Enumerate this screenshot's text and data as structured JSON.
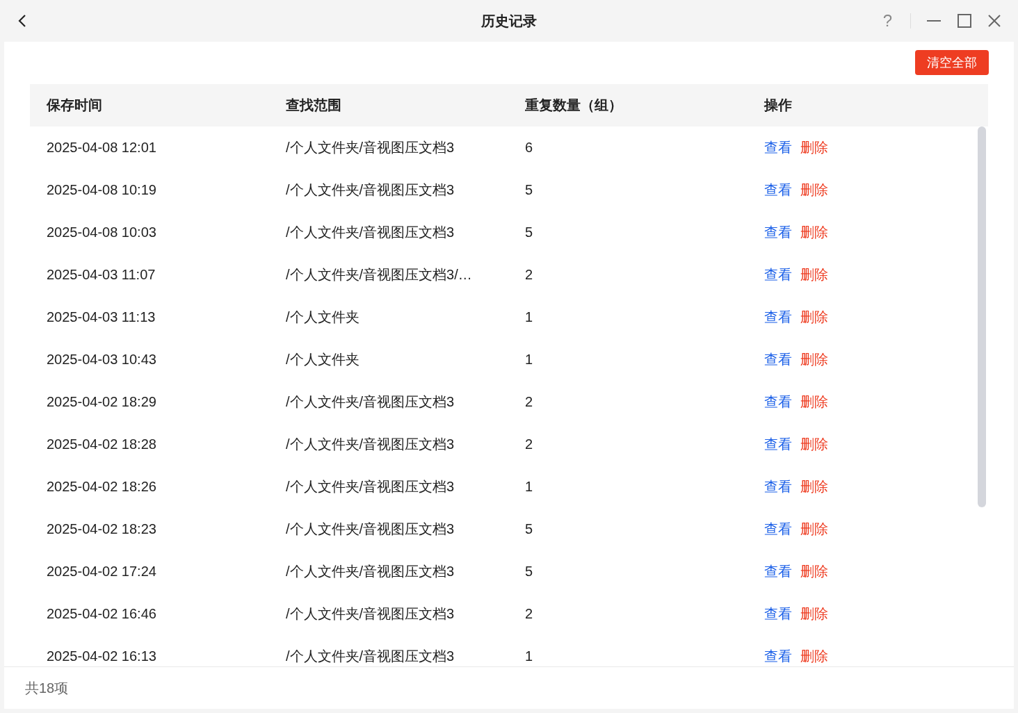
{
  "window": {
    "title": "历史记录",
    "help": "?"
  },
  "clear_all_button": "清空全部",
  "table": {
    "columns": [
      "保存时间",
      "查找范围",
      "重复数量（组）",
      "操作"
    ],
    "rows": [
      {
        "time": "2025-04-08 12:01",
        "scope": "/个人文件夹/音视图压文档3",
        "count": "6",
        "view": "查看",
        "delete": "删除"
      },
      {
        "time": "2025-04-08 10:19",
        "scope": "/个人文件夹/音视图压文档3",
        "count": "5",
        "view": "查看",
        "delete": "删除"
      },
      {
        "time": "2025-04-08 10:03",
        "scope": "/个人文件夹/音视图压文档3",
        "count": "5",
        "view": "查看",
        "delete": "删除"
      },
      {
        "time": "2025-04-03 11:07",
        "scope": "/个人文件夹/音视图压文档3/…",
        "count": "2",
        "view": "查看",
        "delete": "删除"
      },
      {
        "time": "2025-04-03 11:13",
        "scope": "/个人文件夹",
        "count": "1",
        "view": "查看",
        "delete": "删除"
      },
      {
        "time": "2025-04-03 10:43",
        "scope": "/个人文件夹",
        "count": "1",
        "view": "查看",
        "delete": "删除"
      },
      {
        "time": "2025-04-02 18:29",
        "scope": "/个人文件夹/音视图压文档3",
        "count": "2",
        "view": "查看",
        "delete": "删除"
      },
      {
        "time": "2025-04-02 18:28",
        "scope": "/个人文件夹/音视图压文档3",
        "count": "2",
        "view": "查看",
        "delete": "删除"
      },
      {
        "time": "2025-04-02 18:26",
        "scope": "/个人文件夹/音视图压文档3",
        "count": "1",
        "view": "查看",
        "delete": "删除"
      },
      {
        "time": "2025-04-02 18:23",
        "scope": "/个人文件夹/音视图压文档3",
        "count": "5",
        "view": "查看",
        "delete": "删除"
      },
      {
        "time": "2025-04-02 17:24",
        "scope": "/个人文件夹/音视图压文档3",
        "count": "5",
        "view": "查看",
        "delete": "删除"
      },
      {
        "time": "2025-04-02 16:46",
        "scope": "/个人文件夹/音视图压文档3",
        "count": "2",
        "view": "查看",
        "delete": "删除"
      },
      {
        "time": "2025-04-02 16:13",
        "scope": "/个人文件夹/音视图压文档3",
        "count": "1",
        "view": "查看",
        "delete": "删除"
      }
    ]
  },
  "status_bar": "共18项"
}
